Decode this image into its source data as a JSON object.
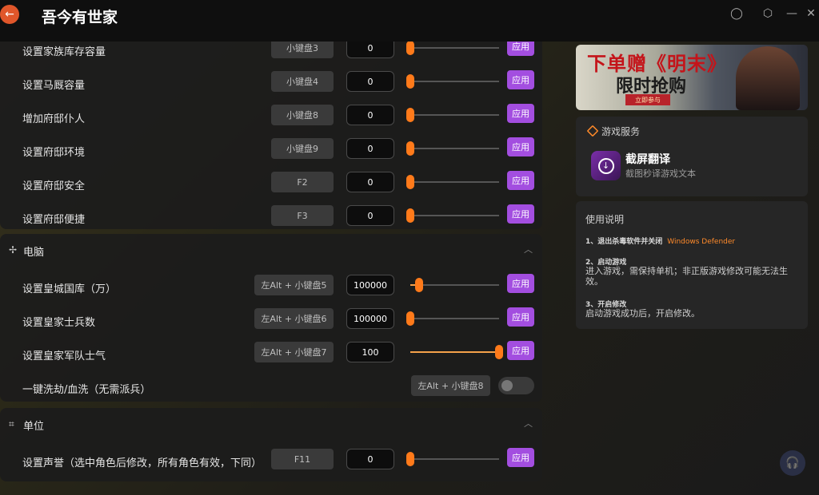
{
  "app": {
    "title": "吾今有世家"
  },
  "sections": {
    "top_rows": [
      {
        "label": "设置家族库存容量",
        "hotkey": "小键盘3",
        "value": "0",
        "apply": "应用"
      },
      {
        "label": "设置马厩容量",
        "hotkey": "小键盘4",
        "value": "0",
        "apply": "应用"
      },
      {
        "label": "增加府邸仆人",
        "hotkey": "小键盘8",
        "value": "0",
        "apply": "应用"
      },
      {
        "label": "设置府邸环境",
        "hotkey": "小键盘9",
        "value": "0",
        "apply": "应用"
      },
      {
        "label": "设置府邸安全",
        "hotkey": "F2",
        "value": "0",
        "apply": "应用"
      },
      {
        "label": "设置府邸便捷",
        "hotkey": "F3",
        "value": "0",
        "apply": "应用"
      }
    ],
    "computer": {
      "title": "电脑",
      "rows": [
        {
          "label": "设置皇城国库（万）",
          "hotkey": "左Alt + 小键盘5",
          "value": "100000",
          "apply": "应用",
          "slider": 0.1
        },
        {
          "label": "设置皇家士兵数",
          "hotkey": "左Alt + 小键盘6",
          "value": "100000",
          "apply": "应用",
          "slider": 0.0
        },
        {
          "label": "设置皇家军队士气",
          "hotkey": "左Alt + 小键盘7",
          "value": "100",
          "apply": "应用",
          "slider": 1.0
        }
      ],
      "toggle_row": {
        "label": "一键洗劫/血洗（无需派兵）",
        "hotkey": "左Alt + 小键盘8",
        "on": false
      }
    },
    "unit": {
      "title": "单位",
      "rows": [
        {
          "label": "设置声誉（选中角色后修改，所有角色有效，下同）",
          "hotkey": "F11",
          "value": "0",
          "apply": "应用",
          "slider": 0.0
        }
      ]
    }
  },
  "sidebar": {
    "banner": {
      "line1": "下单赠《明末》",
      "line2": "限时抢购",
      "cta": "立即参与"
    },
    "service": {
      "heading": "游戏服务",
      "title": "截屏翻译",
      "subtitle": "截图秒译游戏文本"
    },
    "guide": {
      "title": "使用说明",
      "step1_title": "1、退出杀毒软件并关闭",
      "step1_link": "Windows Defender",
      "step2_title": "2、启动游戏",
      "step2_body": "进入游戏，需保持单机；非正版游戏修改可能无法生效。",
      "step3_title": "3、开启修改",
      "step3_body": "启动游戏成功后，开启修改。"
    }
  },
  "colors": {
    "accent_purple": "#a34ee0",
    "slider_orange": "#ff7a1a",
    "link_orange": "#ff8a2a"
  }
}
